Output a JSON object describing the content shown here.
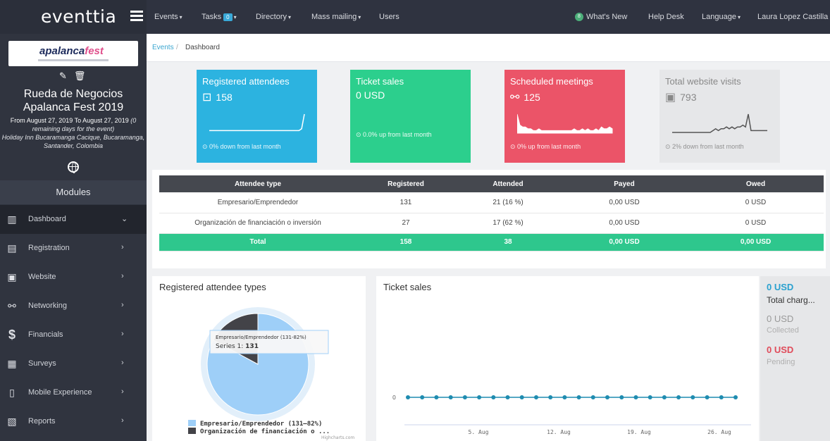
{
  "app": {
    "logo": "eventtia"
  },
  "nav": {
    "events": "Events",
    "tasks": "Tasks",
    "tasks_badge": "0",
    "directory": "Directory",
    "mass_mailing": "Mass mailing",
    "users": "Users",
    "whats_new_badge": "8",
    "whats_new": "What's New",
    "help_desk": "Help Desk",
    "language": "Language",
    "user": "Laura Lopez Castilla"
  },
  "event": {
    "logo_a": "apalanca",
    "logo_b": "fest",
    "title": "Rueda de Negocios Apalanca Fest 2019",
    "dates": "From August 27, 2019 To August 27, 2019",
    "remaining": "(0 remaining days for the event)",
    "location": "Holiday Inn Bucaramanga Cacique, Bucaramanga, Santander, Colombia"
  },
  "sidebar": {
    "modules_label": "Modules",
    "items": [
      {
        "label": "Dashboard",
        "icon": "dashboard-icon"
      },
      {
        "label": "Registration",
        "icon": "registration-icon"
      },
      {
        "label": "Website",
        "icon": "website-icon"
      },
      {
        "label": "Networking",
        "icon": "networking-icon"
      },
      {
        "label": "Financials",
        "icon": "dollar-icon"
      },
      {
        "label": "Surveys",
        "icon": "surveys-icon"
      },
      {
        "label": "Mobile Experience",
        "icon": "mobile-icon"
      },
      {
        "label": "Reports",
        "icon": "reports-icon"
      }
    ]
  },
  "breadcrumb": {
    "link": "Events",
    "current": "Dashboard"
  },
  "stats": [
    {
      "title": "Registered attendees",
      "value": "158",
      "footer": "0% down from last month",
      "color": "#2cb3e0",
      "spark": [
        1,
        1,
        1,
        1,
        1,
        1,
        1,
        1,
        1,
        1,
        1,
        1,
        1,
        1,
        1,
        1,
        1,
        1,
        1,
        1,
        1,
        1,
        1,
        1,
        1,
        1,
        1,
        1,
        1,
        1,
        1,
        1,
        1,
        1,
        2,
        10
      ]
    },
    {
      "title": "Ticket sales",
      "value": "0 USD",
      "footer": "0.0% up from last month",
      "color": "#2ccf8d"
    },
    {
      "title": "Scheduled meetings",
      "value": "125",
      "footer": "0% up from last month",
      "color": "#eb5468",
      "spark": [
        10,
        4,
        3,
        3,
        2,
        2,
        1,
        1,
        2,
        1,
        1,
        1,
        1,
        1,
        1,
        1,
        1,
        1,
        1,
        1,
        1,
        2,
        1,
        1,
        2,
        1,
        2,
        1,
        1,
        2,
        1,
        3,
        2,
        2,
        3,
        2
      ]
    },
    {
      "title": "Total website visits",
      "value": "793",
      "footer": "2% down from last month",
      "color": "#e6e7e9",
      "spark": [
        0,
        0,
        0,
        0,
        0,
        0,
        0,
        0,
        0,
        0,
        0,
        0,
        0,
        0,
        0,
        1,
        2,
        1,
        2,
        2,
        3,
        2,
        3,
        2,
        3,
        3,
        4,
        3,
        10,
        1,
        1,
        1,
        1,
        1,
        1,
        1
      ]
    }
  ],
  "table": {
    "headers": [
      "Attendee type",
      "Registered",
      "Attended",
      "Payed",
      "Owed"
    ],
    "rows": [
      [
        "Empresario/Emprendedor",
        "131",
        "21 (16 %)",
        "0,00 USD",
        "0 USD"
      ],
      [
        "Organización de financiación o inversión",
        "27",
        "17 (62 %)",
        "0,00 USD",
        "0 USD"
      ]
    ],
    "total": [
      "Total",
      "158",
      "38",
      "0,00 USD",
      "0,00 USD"
    ]
  },
  "pie_card": {
    "title": "Registered attendee types",
    "tooltip_title": "Empresario/Emprendedor (131-82%)",
    "tooltip_series": "Series 1:",
    "tooltip_value": "131",
    "legend_1": "Empresario/Emprendedor (131–82%)",
    "legend_2": "Organización de financiación o ...",
    "credit": "Highcharts.com",
    "color_1": "#9ecff8",
    "color_2": "#434348"
  },
  "chart_data": {
    "type": "line",
    "title": "Ticket sales",
    "x_ticks": [
      "5. Aug",
      "12. Aug",
      "19. Aug",
      "26. Aug"
    ],
    "y_ticks": [
      "0"
    ],
    "point_count": 24,
    "values": [
      0,
      0,
      0,
      0,
      0,
      0,
      0,
      0,
      0,
      0,
      0,
      0,
      0,
      0,
      0,
      0,
      0,
      0,
      0,
      0,
      0,
      0,
      0,
      0
    ],
    "color": "#1f8cb0"
  },
  "charges": {
    "total_value": "0 USD",
    "total_label": "Total charg...",
    "collected_value": "0 USD",
    "collected_label": "Collected",
    "pending_value": "0 USD",
    "pending_label": "Pending"
  }
}
